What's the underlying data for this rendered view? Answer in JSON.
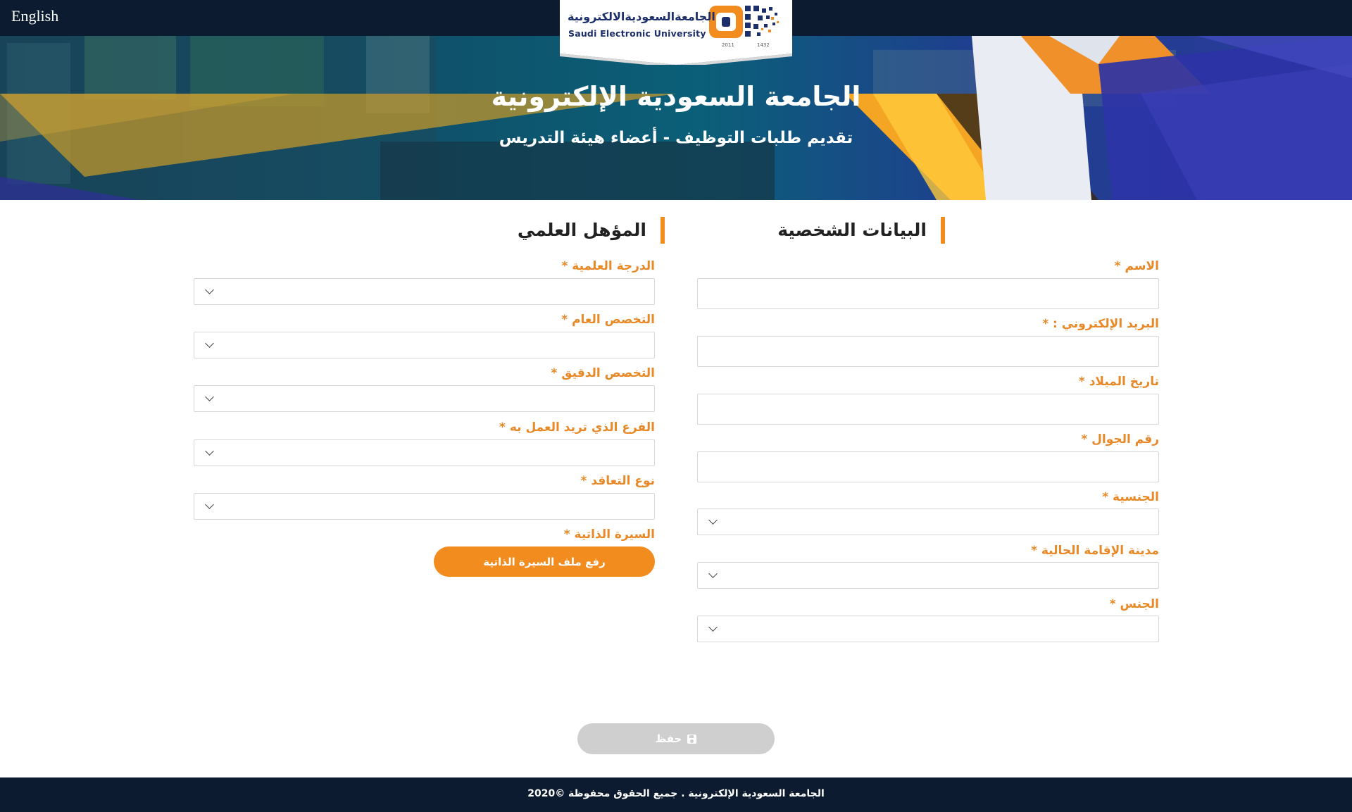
{
  "topbar": {
    "language_link": "English"
  },
  "logo": {
    "arabic_name": "الجامعةالسعوديةالالكترونية",
    "english_name": "Saudi Electronic University",
    "year_gregorian": "2011",
    "year_hijri": "1432"
  },
  "hero": {
    "title": "الجامعة السعودية الإلكترونية",
    "subtitle": "تقديم طلبات التوظيف - أعضاء هيئة التدريس"
  },
  "personal": {
    "section_title": "البيانات الشخصية",
    "name_label": "الاسم *",
    "email_label": "البريد الإلكتروني : *",
    "birthdate_label": "تاريخ الميلاد *",
    "mobile_label": "رقم الجوال *",
    "nationality_label": "الجنسية *",
    "city_label": "مدينة الإقامة الحالية *",
    "gender_label": "الجنس *"
  },
  "academic": {
    "section_title": "المؤهل العلمي",
    "degree_label": "الدرجة العلمية *",
    "general_major_label": "التخصص العام *",
    "specific_major_label": "التخصص الدقيق *",
    "branch_label": "الفرع الذي تريد العمل به *",
    "contract_label": "نوع التعاقد *",
    "cv_label": "السيرة الذاتية *",
    "upload_button": "رفع ملف السيرة الذاتية"
  },
  "actions": {
    "save_label": "حفظ",
    "save_icon": "floppy-disk-icon"
  },
  "footer": {
    "copyright": "الجامعة السعودية الإلكترونية . جميع الحقوق محفوظة ©2020"
  },
  "colors": {
    "accent": "#f28c1e",
    "label": "#e88826",
    "navy": "#0c1b30",
    "save_disabled": "#cfcfcf"
  }
}
